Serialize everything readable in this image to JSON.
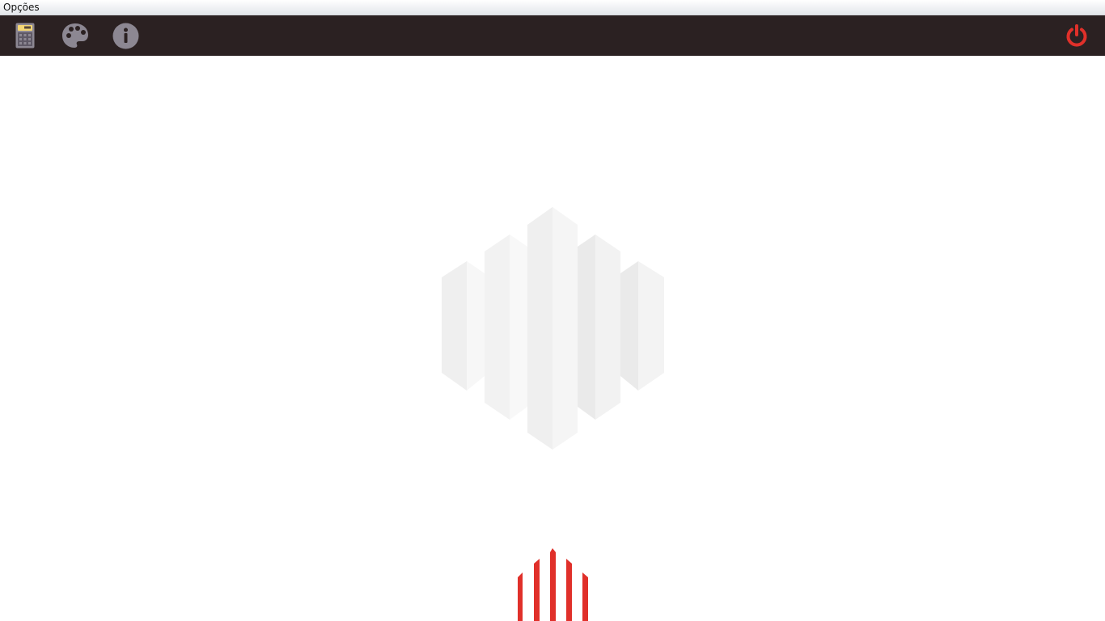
{
  "menubar": {
    "items": [
      {
        "label": "Opções"
      }
    ]
  },
  "toolbar": {
    "buttons": [
      {
        "name": "calculator-button",
        "icon": "calculator-icon"
      },
      {
        "name": "theme-button",
        "icon": "palette-icon"
      },
      {
        "name": "about-button",
        "icon": "info-icon"
      },
      {
        "name": "power-button",
        "icon": "power-icon"
      }
    ]
  },
  "colors": {
    "toolbar_bg": "#2b2122",
    "icon_gray": "#8a8591",
    "power_red": "#e0302a",
    "logo_red": "#e0302a"
  }
}
